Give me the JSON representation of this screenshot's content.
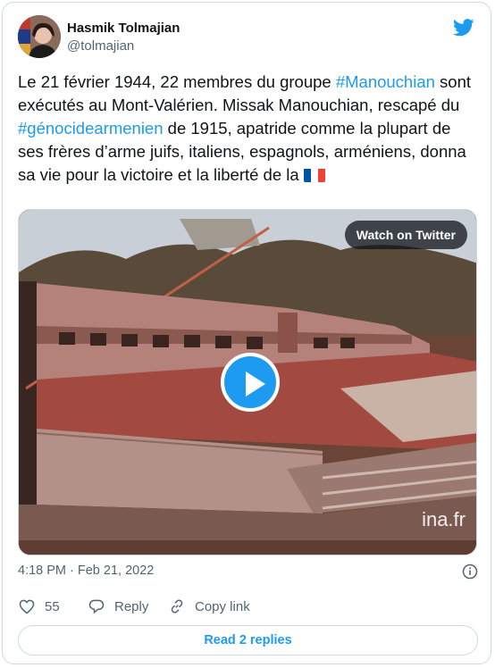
{
  "author": {
    "name": "Hasmik Tolmajian",
    "handle": "@tolmajian"
  },
  "tweet": {
    "segments": [
      {
        "text": "Le 21 février 1944, 22 membres du groupe ",
        "type": "text"
      },
      {
        "text": "#Manouchian",
        "type": "hashtag"
      },
      {
        "text": " sont exécutés au Mont-Valérien. Missak Manouchian, rescapé du ",
        "type": "text"
      },
      {
        "text": "#génocidearmenien",
        "type": "hashtag"
      },
      {
        "text": " de 1915, apatride comme la plupart de ses frères d’arme juifs, italiens, espagnols, arméniens, donna sa vie pour la victoire et la liberté de la ",
        "type": "text"
      }
    ],
    "flag_icon": "france-flag-icon"
  },
  "media": {
    "watch_label": "Watch on Twitter",
    "watermark": "ina.fr"
  },
  "meta": {
    "timestamp": "4:18 PM · Feb 21, 2022"
  },
  "actions": {
    "likes": "55",
    "reply_label": "Reply",
    "copy_label": "Copy link"
  },
  "footer": {
    "read_replies_label": "Read 2 replies"
  },
  "colors": {
    "accent": "#1d9bf0",
    "muted": "#536471",
    "heart": "#536471"
  }
}
